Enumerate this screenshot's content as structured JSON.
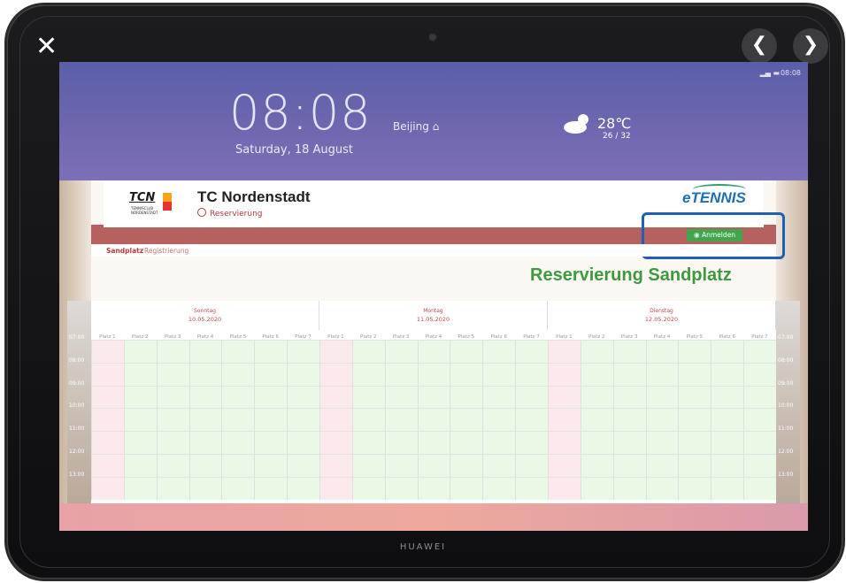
{
  "device": {
    "brand": "HUAWEI",
    "close_glyph": "✕",
    "prev_glyph": "❮",
    "next_glyph": "❯"
  },
  "lockscreen": {
    "time": "08:08",
    "city": "Beijing ⌂",
    "date": "Saturday, 18 August",
    "weather_temp": "28℃",
    "weather_range": "26 / 32",
    "status_time": "08:08"
  },
  "website": {
    "club_name": "TC Nordenstadt",
    "logo_text": "TCN",
    "logo_sub": "TENNISCLUB NORDENSTADT",
    "reservation_link": "Reservierung",
    "brand": "eTENNIS",
    "login_button": "Anmelden",
    "subnav": [
      "Sandplatz",
      "Registrierung"
    ],
    "page_title": "Reservierung Sandplatz",
    "prev_arrow": "❮",
    "next_arrow": "❯",
    "calendar_icon": "calendar-icon",
    "days": [
      {
        "name": "Sonntag",
        "date": "10.05.2020"
      },
      {
        "name": "Montag",
        "date": "11.05.2020"
      },
      {
        "name": "Dienstag",
        "date": "12.05.2020"
      }
    ],
    "courts": [
      "Platz 1",
      "Platz 2",
      "Platz 3",
      "Platz 4",
      "Platz 5",
      "Platz 6",
      "Platz 7"
    ],
    "times": [
      "07:00",
      "08:00",
      "09:00",
      "10:00",
      "11:00",
      "12:00",
      "13:00"
    ]
  },
  "colors": {
    "accent_green": "#3fa64b",
    "title_green": "#3d9a3e",
    "header_red": "#b76060",
    "highlight_blue": "#1f5fb4",
    "free_cell": "#e9f9e6",
    "blocked_cell": "#fbe9ec"
  }
}
